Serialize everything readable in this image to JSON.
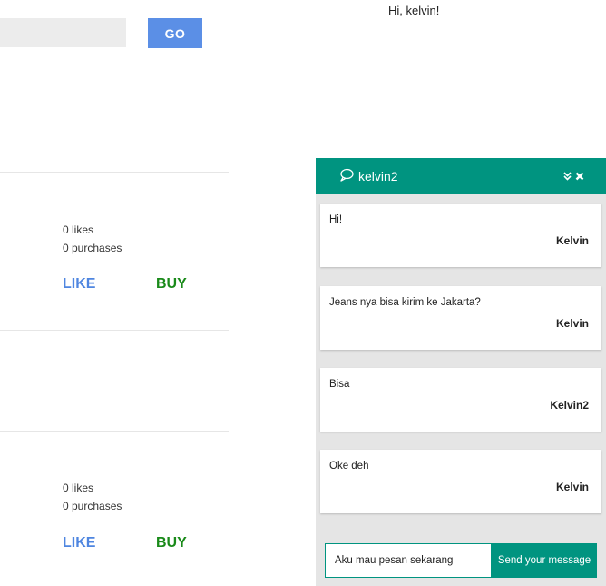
{
  "header": {
    "search": {
      "value": "",
      "placeholder": ""
    },
    "go_label": "GO",
    "greeting": "Hi, kelvin!"
  },
  "products": [
    {
      "likes": "0 likes",
      "purchases": "0 purchases",
      "like_label": "LIKE",
      "buy_label": "BUY"
    },
    {
      "likes": "0 likes",
      "purchases": "0 purchases",
      "like_label": "LIKE",
      "buy_label": "BUY"
    }
  ],
  "chat": {
    "title": "kelvin2",
    "messages": [
      {
        "text": "Hi!",
        "author": "Kelvin"
      },
      {
        "text": "Jeans nya bisa kirim ke Jakarta?",
        "author": "Kelvin"
      },
      {
        "text": "Bisa",
        "author": "Kelvin2"
      },
      {
        "text": "Oke deh",
        "author": "Kelvin"
      }
    ],
    "input_value": "Aku mau pesan sekarang",
    "send_label": "Send your message"
  },
  "colors": {
    "go_button": "#5b8fe6",
    "like": "#4f86e0",
    "buy": "#1a8a1a",
    "chat_accent": "#009480"
  },
  "icons": [
    "chat-bubble-icon",
    "minimize-chevrons-icon",
    "close-icon"
  ]
}
